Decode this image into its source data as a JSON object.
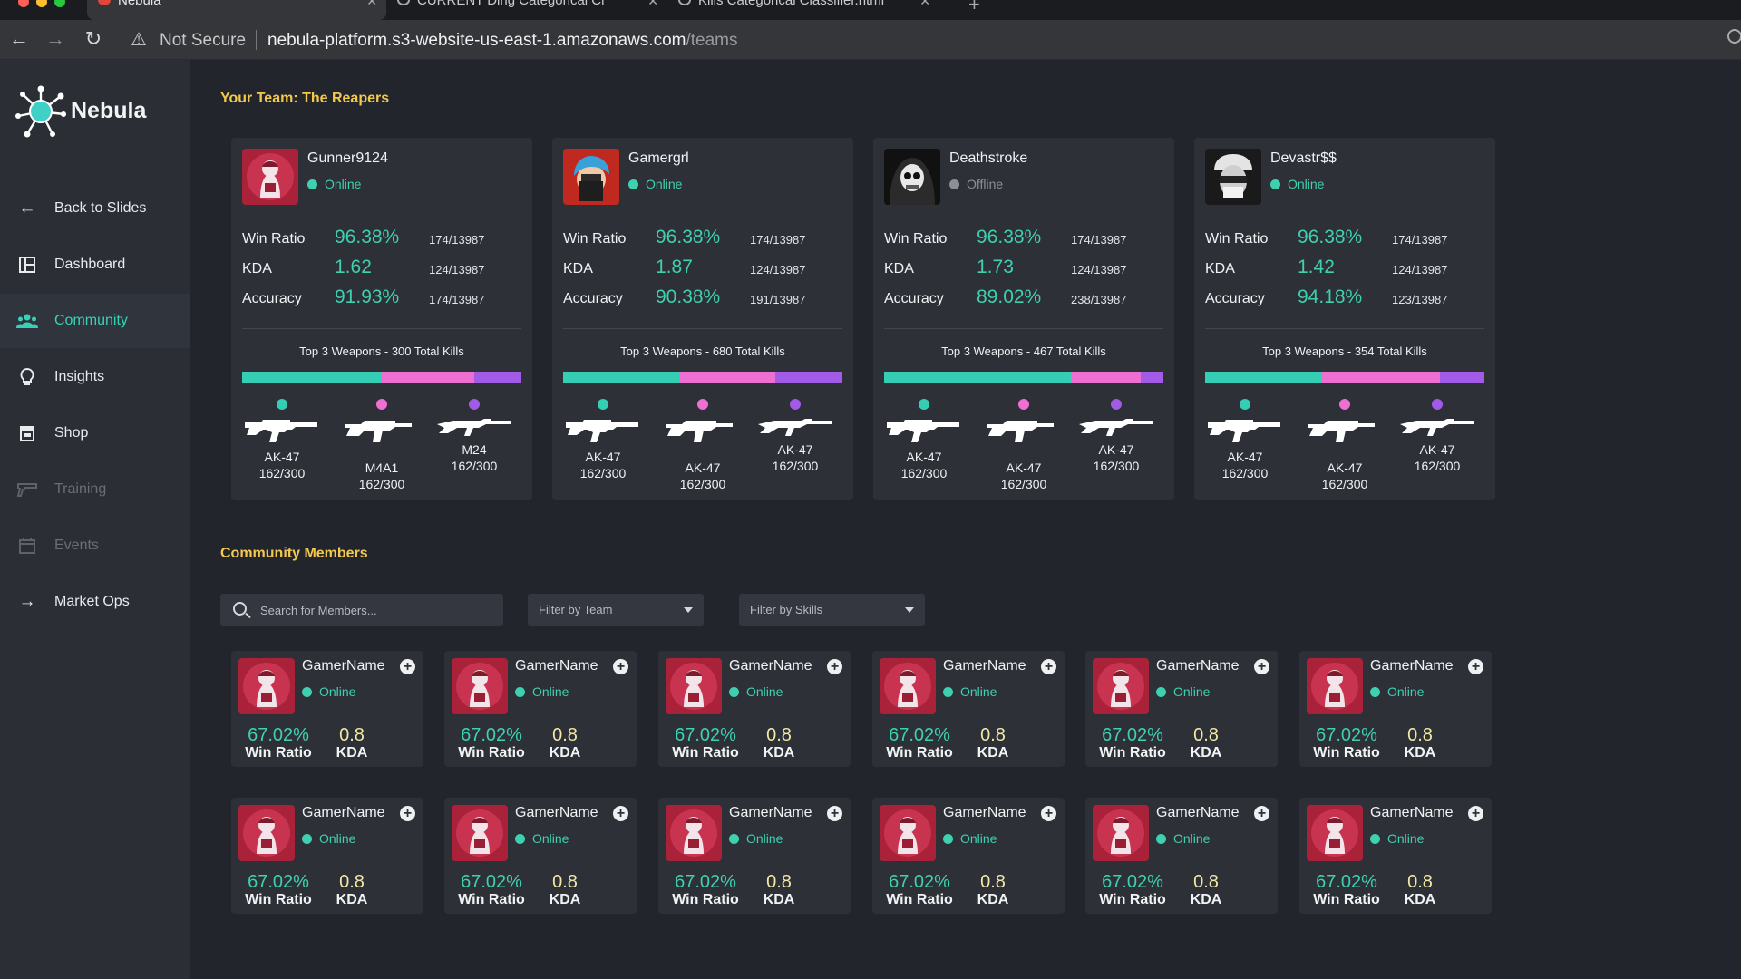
{
  "browser": {
    "tabs": [
      {
        "title": "Nebula",
        "active": true
      },
      {
        "title": "CURRENT Ding Categorical Cl",
        "active": false
      },
      {
        "title": "Kills Categorical Classifier.html",
        "active": false
      }
    ],
    "security_label": "Not Secure",
    "url_host": "nebula-platform.s3-website-us-east-1.amazonaws.com",
    "url_path": "/teams"
  },
  "sidebar": {
    "logo_text": "Nebula",
    "items": [
      {
        "label": "Back to Slides",
        "icon": "arrow-left-icon",
        "state": "normal"
      },
      {
        "label": "Dashboard",
        "icon": "dashboard-icon",
        "state": "normal"
      },
      {
        "label": "Community",
        "icon": "users-icon",
        "state": "active"
      },
      {
        "label": "Insights",
        "icon": "lightbulb-icon",
        "state": "normal"
      },
      {
        "label": "Shop",
        "icon": "shop-icon",
        "state": "normal"
      },
      {
        "label": "Training",
        "icon": "gun-icon",
        "state": "disabled"
      },
      {
        "label": "Events",
        "icon": "calendar-icon",
        "state": "disabled"
      },
      {
        "label": "Market Ops",
        "icon": "arrow-right-icon",
        "state": "normal"
      }
    ]
  },
  "team": {
    "heading": "Your Team: The Reapers",
    "stat_labels": {
      "win": "Win Ratio",
      "kda": "KDA",
      "acc": "Accuracy"
    },
    "weapon_colors": [
      "#35cdb4",
      "#ec6fd1",
      "#a25be6"
    ],
    "players": [
      {
        "name": "Gunner9124",
        "status": "Online",
        "avatar": "red-hood-avatar",
        "win_ratio": "96.38%",
        "win_frac": "174/13987",
        "kda": "1.62",
        "kda_frac": "124/13987",
        "accuracy": "91.93%",
        "acc_frac": "174/13987",
        "weapons_title": "Top 3 Weapons - 300 Total Kills",
        "kill_share": [
          0.5,
          0.33,
          0.17
        ],
        "weapons": [
          {
            "name": "AK-47",
            "count": "162/300"
          },
          {
            "name": "M4A1",
            "count": "162/300"
          },
          {
            "name": "M24",
            "count": "162/300"
          }
        ]
      },
      {
        "name": "Gamergrl",
        "status": "Online",
        "avatar": "blue-hair-avatar",
        "win_ratio": "96.38%",
        "win_frac": "174/13987",
        "kda": "1.87",
        "kda_frac": "124/13987",
        "accuracy": "90.38%",
        "acc_frac": "191/13987",
        "weapons_title": "Top 3 Weapons - 680 Total Kills",
        "kill_share": [
          0.42,
          0.34,
          0.24
        ],
        "weapons": [
          {
            "name": "AK-47",
            "count": "162/300"
          },
          {
            "name": "AK-47",
            "count": "162/300"
          },
          {
            "name": "AK-47",
            "count": "162/300"
          }
        ]
      },
      {
        "name": "Deathstroke",
        "status": "Offline",
        "avatar": "skull-hood-avatar",
        "win_ratio": "96.38%",
        "win_frac": "174/13987",
        "kda": "1.73",
        "kda_frac": "124/13987",
        "accuracy": "89.02%",
        "acc_frac": "238/13987",
        "weapons_title": "Top 3 Weapons - 467 Total Kills",
        "kill_share": [
          0.67,
          0.25,
          0.08
        ],
        "weapons": [
          {
            "name": "AK-47",
            "count": "162/300"
          },
          {
            "name": "AK-47",
            "count": "162/300"
          },
          {
            "name": "AK-47",
            "count": "162/300"
          }
        ]
      },
      {
        "name": "Devastr$$",
        "status": "Online",
        "avatar": "skull-cap-avatar",
        "win_ratio": "96.38%",
        "win_frac": "174/13987",
        "kda": "1.42",
        "kda_frac": "124/13987",
        "accuracy": "94.18%",
        "acc_frac": "123/13987",
        "weapons_title": "Top 3 Weapons - 354 Total Kills",
        "kill_share": [
          0.42,
          0.42,
          0.16
        ],
        "weapons": [
          {
            "name": "AK-47",
            "count": "162/300"
          },
          {
            "name": "AK-47",
            "count": "162/300"
          },
          {
            "name": "AK-47",
            "count": "162/300"
          }
        ]
      }
    ]
  },
  "community": {
    "heading": "Community Members",
    "search_placeholder": "Search for Members...",
    "filter_team": "Filter by Team",
    "filter_skills": "Filter by Skills",
    "members": [
      {
        "name": "GamerName",
        "status": "Online",
        "win_ratio": "67.02%",
        "kda": "0.8"
      },
      {
        "name": "GamerName",
        "status": "Online",
        "win_ratio": "67.02%",
        "kda": "0.8"
      },
      {
        "name": "GamerName",
        "status": "Online",
        "win_ratio": "67.02%",
        "kda": "0.8"
      },
      {
        "name": "GamerName",
        "status": "Online",
        "win_ratio": "67.02%",
        "kda": "0.8"
      },
      {
        "name": "GamerName",
        "status": "Online",
        "win_ratio": "67.02%",
        "kda": "0.8"
      },
      {
        "name": "GamerName",
        "status": "Online",
        "win_ratio": "67.02%",
        "kda": "0.8"
      },
      {
        "name": "GamerName",
        "status": "Online",
        "win_ratio": "67.02%",
        "kda": "0.8"
      },
      {
        "name": "GamerName",
        "status": "Online",
        "win_ratio": "67.02%",
        "kda": "0.8"
      },
      {
        "name": "GamerName",
        "status": "Online",
        "win_ratio": "67.02%",
        "kda": "0.8"
      },
      {
        "name": "GamerName",
        "status": "Online",
        "win_ratio": "67.02%",
        "kda": "0.8"
      },
      {
        "name": "GamerName",
        "status": "Online",
        "win_ratio": "67.02%",
        "kda": "0.8"
      },
      {
        "name": "GamerName",
        "status": "Online",
        "win_ratio": "67.02%",
        "kda": "0.8"
      }
    ],
    "win_label": "Win Ratio",
    "kda_label": "KDA"
  }
}
